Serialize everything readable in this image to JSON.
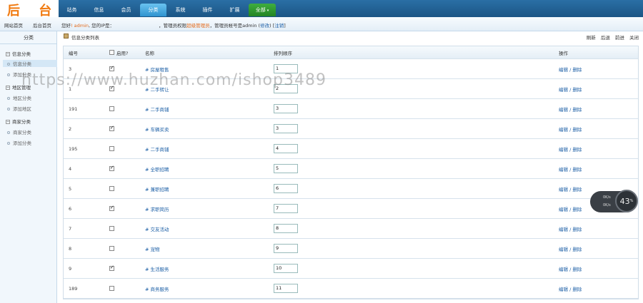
{
  "logo": "后 台",
  "nav": [
    {
      "label": "站务"
    },
    {
      "label": "信息"
    },
    {
      "label": "会员"
    },
    {
      "label": "分类"
    },
    {
      "label": "系统"
    },
    {
      "label": "插件"
    },
    {
      "label": "扩展"
    },
    {
      "label": "全部"
    }
  ],
  "subbar": {
    "link1": "网站首页",
    "link2": "后台首页",
    "welcome_a": "您好",
    "user": "! admin",
    "welcome_b": ", 您的IP是：",
    "notice_a": "，管理员权限",
    "notice_b": "超级管理员",
    "notice_c": "，管理员帐号是admin",
    "modify": "修改",
    "logout": "注销"
  },
  "sidebar": {
    "title": "分类",
    "groups": [
      {
        "label": "信息分类",
        "items": [
          "信息分类",
          "添加分类"
        ]
      },
      {
        "label": "地区管理",
        "items": [
          "地区分类",
          "添加地区"
        ]
      },
      {
        "label": "商家分类",
        "items": [
          "商家分类",
          "添加分类"
        ]
      }
    ]
  },
  "content": {
    "title": "信息分类列表",
    "actions": [
      "刷新",
      "后退",
      "前进",
      "关闭"
    ]
  },
  "table": {
    "headers": {
      "id": "编号",
      "enabled": "启用?",
      "name": "名称",
      "order": "排列顺序",
      "op": "操作"
    },
    "rows": [
      {
        "id": "3",
        "enabled": true,
        "name": "# 房屋租售",
        "order": "1",
        "op": "编辑 / 删除"
      },
      {
        "id": "1",
        "enabled": true,
        "name": "# 二手转让",
        "order": "2",
        "op": "编辑 / 删除"
      },
      {
        "id": "191",
        "enabled": false,
        "name": "# 二手商铺",
        "order": "3",
        "op": "编辑 / 删除"
      },
      {
        "id": "2",
        "enabled": true,
        "name": "# 车辆买卖",
        "order": "3",
        "op": "编辑 / 删除"
      },
      {
        "id": "195",
        "enabled": false,
        "name": "# 二手商铺",
        "order": "4",
        "op": "编辑 / 删除"
      },
      {
        "id": "4",
        "enabled": true,
        "name": "# 全职招聘",
        "order": "5",
        "op": "编辑 / 删除"
      },
      {
        "id": "5",
        "enabled": false,
        "name": "# 兼职招聘",
        "order": "6",
        "op": "编辑 / 删除"
      },
      {
        "id": "6",
        "enabled": true,
        "name": "# 求职简历",
        "order": "7",
        "op": "编辑 / 删除"
      },
      {
        "id": "7",
        "enabled": false,
        "name": "# 交友活动",
        "order": "8",
        "op": "编辑 / 删除"
      },
      {
        "id": "8",
        "enabled": false,
        "name": "# 宠物",
        "order": "9",
        "op": "编辑 / 删除"
      },
      {
        "id": "9",
        "enabled": true,
        "name": "# 生活服务",
        "order": "10",
        "op": "编辑 / 删除"
      },
      {
        "id": "189",
        "enabled": false,
        "name": "# 商务服务",
        "order": "11",
        "op": "编辑 / 删除"
      }
    ]
  },
  "watermark": "https://www.huzhan.com/ishop3489",
  "speed": {
    "up": "0K/s",
    "down": "0K/s",
    "percent": "43",
    "unit": "%"
  },
  "colors": {
    "nav": "#1b5585",
    "active": "#2f93cf",
    "all": "#238423",
    "logo": "#f07a10",
    "link": "#1c5fa6"
  }
}
